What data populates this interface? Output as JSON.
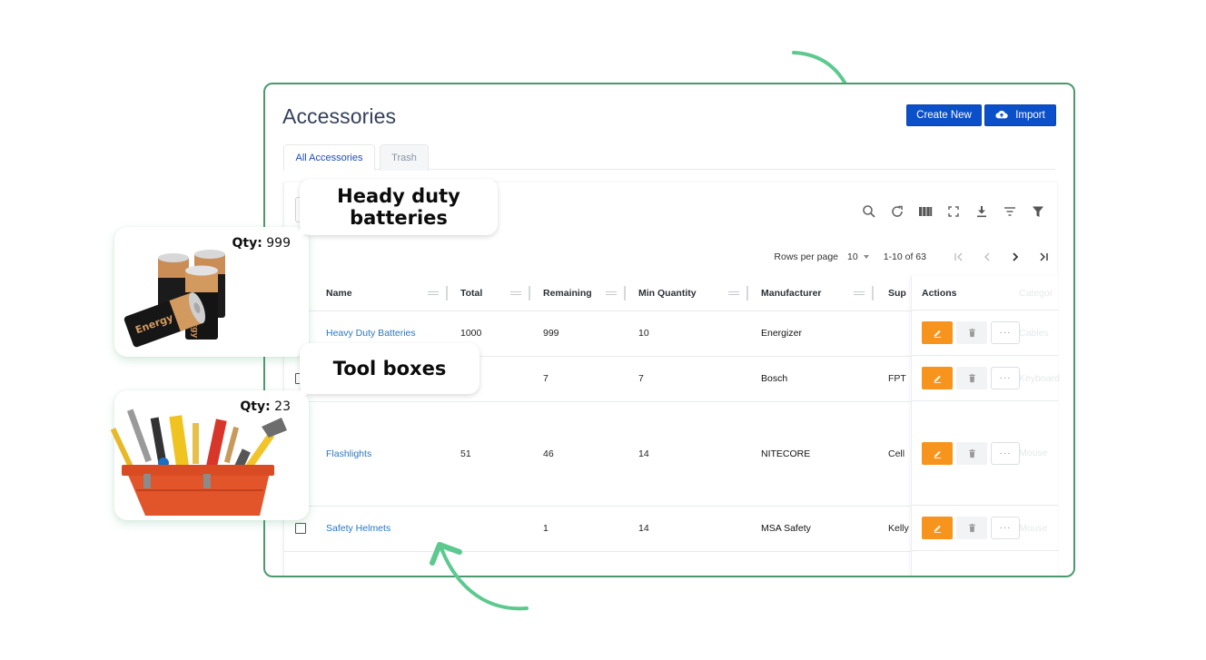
{
  "page": {
    "title": "Accessories",
    "create_label": "Create New",
    "import_label": "Import",
    "import_icon": "cloud-upload-icon"
  },
  "tabs": [
    {
      "label": "All Accessories",
      "active": true
    },
    {
      "label": "Trash",
      "active": false
    }
  ],
  "toolbar": {
    "icons": [
      "search-icon",
      "refresh-icon",
      "columns-icon",
      "fullscreen-icon",
      "download-icon",
      "sort-filter-icon",
      "funnel-icon"
    ]
  },
  "pagination": {
    "rows_label": "Rows per page",
    "rows_value": "10",
    "range": "1-10 of 63"
  },
  "table": {
    "columns": [
      "Name",
      "Total",
      "Remaining",
      "Min Quantity",
      "Manufacturer",
      "Sup",
      "Actions",
      "Categor"
    ],
    "rows": [
      {
        "name": "Heavy Duty Batteries",
        "total": "1000",
        "remaining": "999",
        "min_qty": "10",
        "manufacturer": "Energizer",
        "supplier": "",
        "category": "Cables",
        "checkbox": false
      },
      {
        "name": "",
        "total": "",
        "remaining": "7",
        "min_qty": "7",
        "manufacturer": "Bosch",
        "supplier": "FPT",
        "category": "Keyboard",
        "checkbox": true
      },
      {
        "name": "Flashlights",
        "total": "51",
        "remaining": "46",
        "min_qty": "14",
        "manufacturer": "NITECORE",
        "supplier": "Cell",
        "category": "Mouse",
        "checkbox": false
      },
      {
        "name": "Safety Helmets",
        "total": "",
        "remaining": "1",
        "min_qty": "14",
        "manufacturer": "MSA Safety",
        "supplier": "Kelly",
        "category": "Mouse",
        "checkbox": true
      }
    ],
    "more_label": "···"
  },
  "callouts": {
    "batteries": {
      "title_line1": "Heady duty",
      "title_line2": "batteries",
      "qty_label": "Qty:",
      "qty_value": "999"
    },
    "toolboxes": {
      "title": "Tool boxes",
      "qty_label": "Qty:",
      "qty_value": "23"
    }
  },
  "colors": {
    "accent_green": "#5cc98f",
    "card_border": "#4a9a6e",
    "primary_blue": "#0b4fc9",
    "edit_orange": "#f7941d",
    "link_blue": "#2a77c3"
  }
}
